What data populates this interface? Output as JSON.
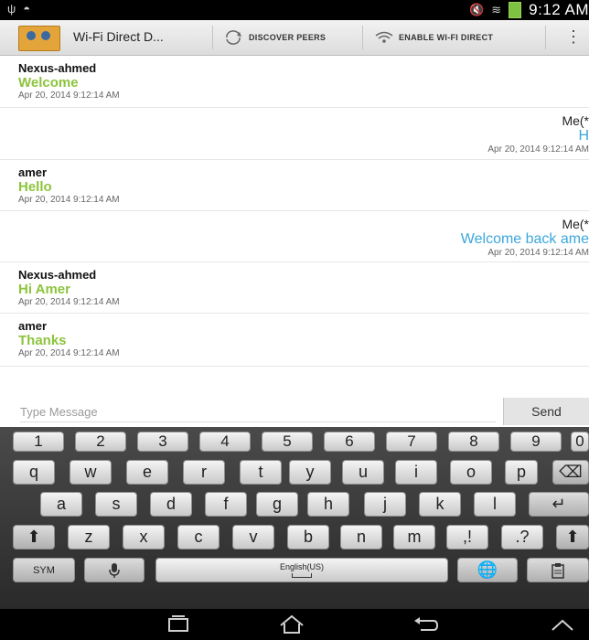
{
  "statusbar": {
    "time": "9:12 AM"
  },
  "actionbar": {
    "title": "Wi-Fi Direct D...",
    "discover_label": "DISCOVER PEERS",
    "enable_label": "ENABLE WI-FI DIRECT"
  },
  "messages": [
    {
      "sender": "Nexus-ahmed",
      "text": "Welcome",
      "time": "Apr 20, 2014 9:12:14 AM"
    },
    {
      "sender": "Me(*",
      "text": "H",
      "time": "Apr 20, 2014 9:12:14 AM"
    },
    {
      "sender": "amer",
      "text": "Hello",
      "time": "Apr 20, 2014 9:12:14 AM"
    },
    {
      "sender": "Me(*",
      "text": "Welcome back ame",
      "time": "Apr 20, 2014 9:12:14 AM"
    },
    {
      "sender": "Nexus-ahmed",
      "text": "Hi Amer",
      "time": "Apr 20, 2014 9:12:14 AM"
    },
    {
      "sender": "amer",
      "text": "Thanks",
      "time": "Apr 20, 2014 9:12:14 AM"
    }
  ],
  "compose": {
    "placeholder": "Type Message",
    "send_label": "Send"
  },
  "keyboard": {
    "number_row": [
      "1",
      "2",
      "3",
      "4",
      "5",
      "6",
      "7",
      "8",
      "9",
      "0"
    ],
    "row1": [
      "q",
      "w",
      "e",
      "r",
      "t",
      "y",
      "u",
      "i",
      "o",
      "p"
    ],
    "row2": [
      "a",
      "s",
      "d",
      "f",
      "g",
      "h",
      "j",
      "k",
      "l"
    ],
    "row3": [
      "z",
      "x",
      "c",
      "v",
      "b",
      "n",
      "m",
      ",!",
      ".?"
    ],
    "sym_label": "SYM",
    "space_label": "English(US)"
  }
}
